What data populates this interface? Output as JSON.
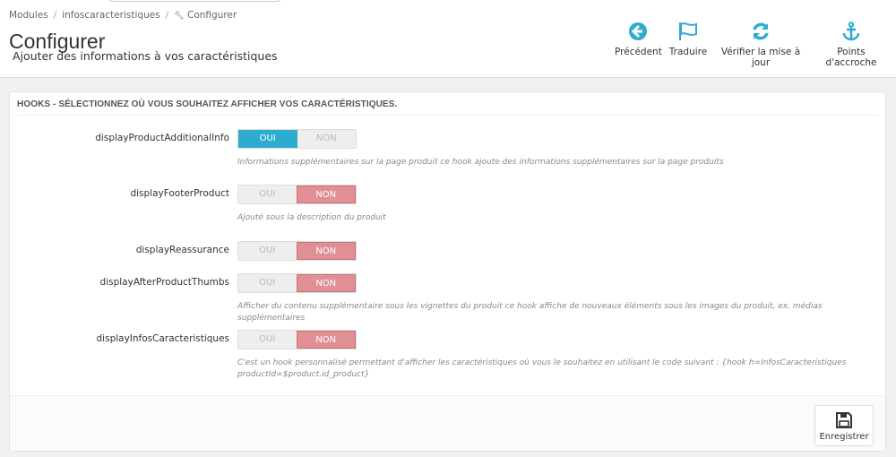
{
  "breadcrumb": [
    "Modules",
    "infoscaracteristiques",
    "Configurer"
  ],
  "header": {
    "title": "Configurer",
    "subtitle": "Ajouter des informations à vos caractéristiques"
  },
  "toolbar": [
    {
      "label": "Précédent",
      "icon": "back-circle-icon"
    },
    {
      "label": "Traduire",
      "icon": "flag-icon"
    },
    {
      "label": "Vérifier la mise à jour",
      "icon": "refresh-icon"
    },
    {
      "label": "Points d'accroche",
      "icon": "anchor-icon"
    }
  ],
  "panel": {
    "title": "HOOKS - SÉLECTIONNEZ OÙ VOUS SOUHAITEZ AFFICHER VOS CARACTÉRISTIQUES.",
    "yes": "OUI",
    "no": "NON",
    "hooks": [
      {
        "name": "displayProductAdditionalInfo",
        "value": "OUI",
        "help": "Informations supplémentaires sur la page produit ce hook ajoute des informations supplémentaires sur la page produits"
      },
      {
        "name": "displayFooterProduct",
        "value": "NON",
        "help": "Ajouté sous la description du produit"
      },
      {
        "name": "displayReassurance",
        "value": "NON",
        "help": ""
      },
      {
        "name": "displayAfterProductThumbs",
        "value": "NON",
        "help": "Afficher du contenu supplémentaire sous les vignettes du produit ce hook affiche de nouveaux éléments sous les images du produit, ex. médias supplémentaires"
      },
      {
        "name": "displayInfosCaracteristiques",
        "value": "NON",
        "help": "C'est un hook personnalisé permettant d'afficher les caractéristiques où vous le souhaitez en utilisant le code suivant : {hook h=InfosCaracteristiques productId=$product.id_product}"
      }
    ],
    "save": "Enregistrer"
  },
  "colors": {
    "accent": "#2eacce",
    "no": "#e08f95"
  }
}
